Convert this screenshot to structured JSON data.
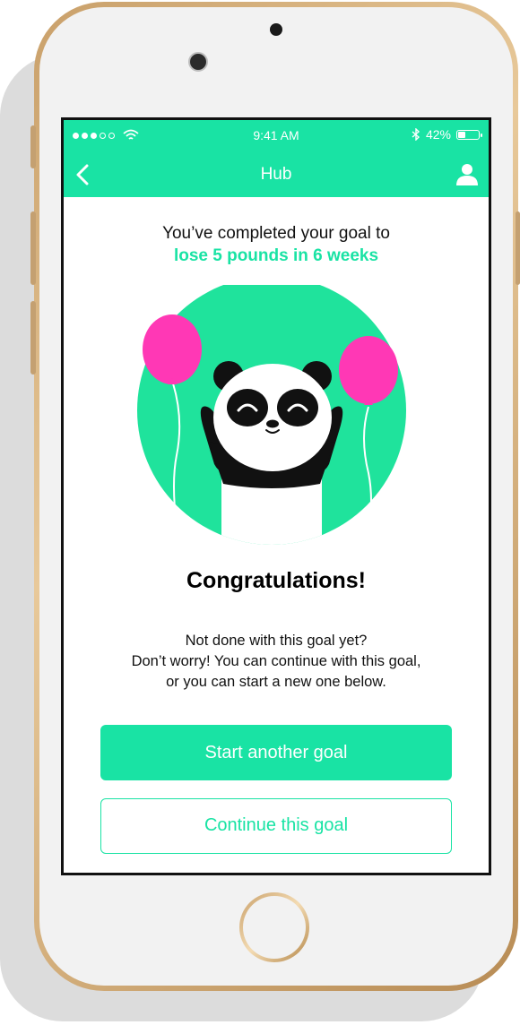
{
  "status_bar": {
    "time": "9:41 AM",
    "battery": "42%",
    "battery_level": 0.42,
    "signal_icon": "signal-dots-icon",
    "wifi_icon": "wifi-icon",
    "bluetooth_icon": "bluetooth-icon"
  },
  "nav": {
    "title": "Hub",
    "back_icon": "chevron-left-icon",
    "profile_icon": "user-icon"
  },
  "goal": {
    "intro": "You’ve completed your goal to",
    "highlight": "lose 5 pounds in 6 weeks"
  },
  "illustration": {
    "description_icon": "panda-balloons-illustration"
  },
  "congrats": {
    "title": "Congratulations!",
    "message_lines": [
      "Not done with this goal yet?",
      "Don’t worry! You can continue with this goal,",
      "or you can start a new one below."
    ]
  },
  "actions": {
    "primary_label": "Start another goal",
    "secondary_label": "Continue this goal"
  },
  "colors": {
    "accent": "#19e3a4",
    "balloon": "#ff38b5",
    "text": "#111111"
  }
}
